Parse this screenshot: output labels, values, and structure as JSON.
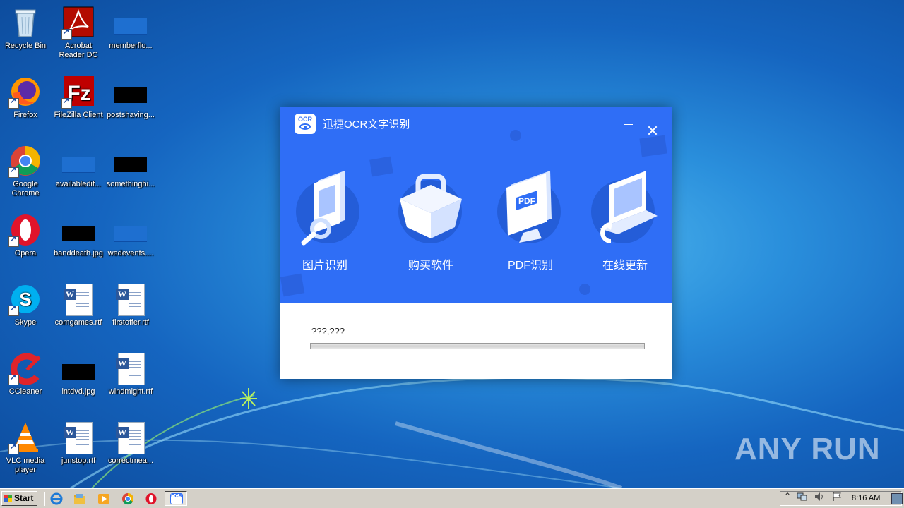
{
  "desktop": {
    "icons": [
      {
        "label": "Recycle Bin"
      },
      {
        "label": "Acrobat Reader DC"
      },
      {
        "label": "memberflo..."
      },
      {
        "label": "Firefox"
      },
      {
        "label": "FileZilla Client"
      },
      {
        "label": "postshaving..."
      },
      {
        "label": "Google Chrome"
      },
      {
        "label": "availabledif..."
      },
      {
        "label": "somethinghi..."
      },
      {
        "label": "Opera"
      },
      {
        "label": "banddeath.jpg"
      },
      {
        "label": "wedevents...."
      },
      {
        "label": "Skype"
      },
      {
        "label": "comgames.rtf"
      },
      {
        "label": "firstoffer.rtf"
      },
      {
        "label": "CCleaner"
      },
      {
        "label": "intdvd.jpg"
      },
      {
        "label": "windmight.rtf"
      },
      {
        "label": "VLC media player"
      },
      {
        "label": "junstop.rtf"
      },
      {
        "label": "correctmea..."
      }
    ],
    "watermark": "ANY RUN"
  },
  "dialog": {
    "logo_text": "OCR",
    "title": "迅捷OCR文字识别",
    "features": [
      {
        "label": "图片识别",
        "icon": "image-recognition-icon"
      },
      {
        "label": "购买软件",
        "icon": "shopping-basket-icon"
      },
      {
        "label": "PDF识别",
        "icon": "pdf-recognition-icon"
      },
      {
        "label": "在线更新",
        "icon": "online-update-icon"
      }
    ],
    "pdf_badge": "PDF",
    "status_text": "???,???",
    "progress": 0,
    "accent_color": "#2f6ef6"
  },
  "taskbar": {
    "start_label": "Start",
    "quick_launch": [
      "internet-explorer-icon",
      "explorer-folder-icon",
      "media-player-icon",
      "chrome-icon",
      "opera-icon"
    ],
    "active_task": "OCR",
    "clock": "8:16 AM"
  }
}
